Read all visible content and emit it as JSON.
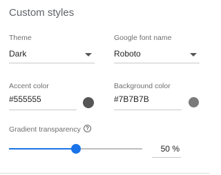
{
  "panel": {
    "title": "Custom styles"
  },
  "theme": {
    "label": "Theme",
    "value": "Dark"
  },
  "font": {
    "label": "Google font name",
    "value": "Roboto"
  },
  "accent": {
    "label": "Accent color",
    "value": "#555555",
    "swatch_color": "#555555"
  },
  "background": {
    "label": "Background color",
    "value": "#7B7B7B",
    "swatch_color": "#7B7B7B"
  },
  "gradient": {
    "label": "Gradient transparency",
    "help_icon": "?",
    "value": 50,
    "value_text": "50",
    "unit": "%"
  },
  "colors": {
    "accent_blue": "#1a73e8"
  }
}
